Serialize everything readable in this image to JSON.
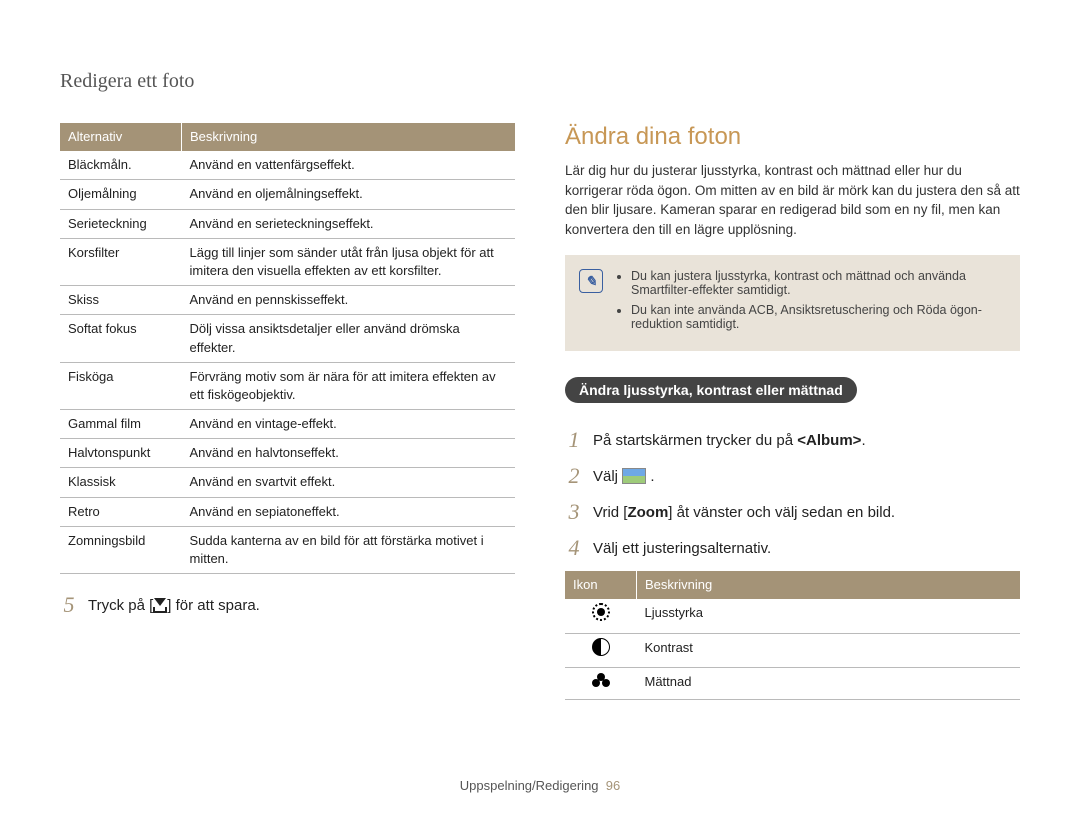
{
  "page_title": "Redigera ett foto",
  "left": {
    "table": {
      "head": [
        "Alternativ",
        "Beskrivning"
      ],
      "rows": [
        [
          "Bläckmåln.",
          "Använd en vattenfärgseffekt."
        ],
        [
          "Oljemålning",
          "Använd en oljemålningseffekt."
        ],
        [
          "Serieteckning",
          "Använd en serieteckningseffekt."
        ],
        [
          "Korsfilter",
          "Lägg till linjer som sänder utåt från ljusa objekt för att imitera den visuella effekten av ett korsfilter."
        ],
        [
          "Skiss",
          "Använd en pennskisseffekt."
        ],
        [
          "Softat fokus",
          "Dölj vissa ansiktsdetaljer eller använd drömska effekter."
        ],
        [
          "Fisköga",
          "Förvräng motiv som är nära för att imitera effekten av ett fiskögeobjektiv."
        ],
        [
          "Gammal film",
          "Använd en vintage-effekt."
        ],
        [
          "Halvtonspunkt",
          "Använd en halvtonseffekt."
        ],
        [
          "Klassisk",
          "Använd en svartvit effekt."
        ],
        [
          "Retro",
          "Använd en sepiatoneffekt."
        ],
        [
          "Zomningsbild",
          "Sudda kanterna av en bild för att förstärka motivet i mitten."
        ]
      ]
    },
    "step5_num": "5",
    "step5_pre": "Tryck på [",
    "step5_post": "] för att spara."
  },
  "right": {
    "heading": "Ändra dina foton",
    "intro": "Lär dig hur du justerar ljusstyrka, kontrast och mättnad eller hur du korrigerar röda ögon. Om mitten av en bild är mörk kan du justera den så att den blir ljusare. Kameran sparar en redigerad bild som en ny fil, men kan konvertera den till en lägre upplösning.",
    "notes": [
      "Du kan justera ljusstyrka, kontrast och mättnad och använda Smartfilter-effekter samtidigt.",
      "Du kan inte använda ACB, Ansiktsretuschering och Röda ögon-reduktion samtidigt."
    ],
    "pill": "Ändra ljusstyrka, kontrast eller mättnad",
    "steps": {
      "s1_num": "1",
      "s1_pre": "På startskärmen trycker du på ",
      "s1_bold": "<Album>",
      "s1_post": ".",
      "s2_num": "2",
      "s2_text": "Välj ",
      "s2_post": " .",
      "s3_num": "3",
      "s3_a": "Vrid [",
      "s3_bold": "Zoom",
      "s3_b": "] åt vänster och välj sedan en bild.",
      "s4_num": "4",
      "s4_text": "Välj ett justeringsalternativ."
    },
    "icon_table": {
      "head": [
        "Ikon",
        "Beskrivning"
      ],
      "rows": [
        {
          "icon": "brightness",
          "desc": "Ljusstyrka"
        },
        {
          "icon": "contrast",
          "desc": "Kontrast"
        },
        {
          "icon": "saturation",
          "desc": "Mättnad"
        }
      ]
    }
  },
  "footer": {
    "text": "Uppspelning/Redigering",
    "page": "96"
  }
}
